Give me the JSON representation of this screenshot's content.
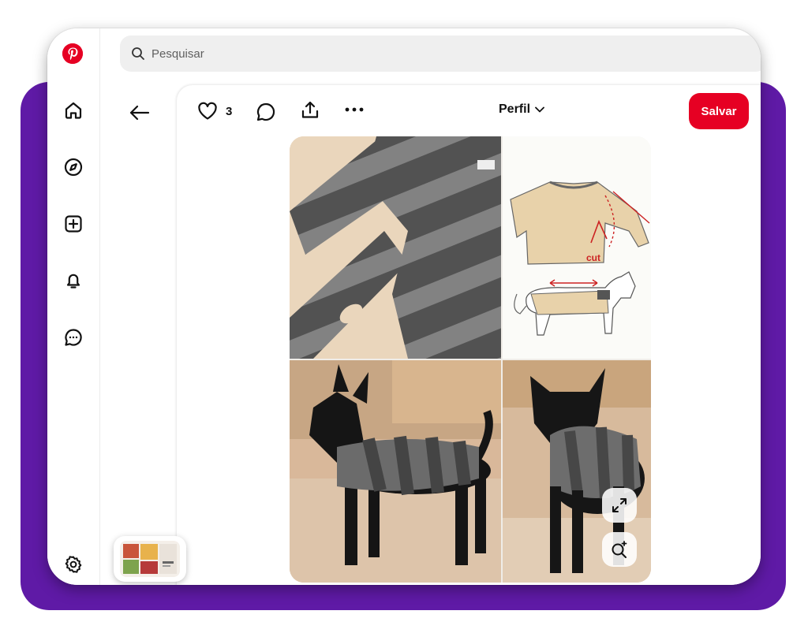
{
  "app": {
    "name": "Pinterest",
    "brand_color": "#e60023",
    "frame_color": "#5f1aa6"
  },
  "sidebar": {
    "items": [
      {
        "name": "home",
        "icon": "home-icon"
      },
      {
        "name": "explore",
        "icon": "compass-icon"
      },
      {
        "name": "create",
        "icon": "plus-square-icon"
      },
      {
        "name": "notifications",
        "icon": "bell-icon"
      },
      {
        "name": "messages",
        "icon": "chat-icon"
      },
      {
        "name": "settings",
        "icon": "gear-icon"
      }
    ]
  },
  "search": {
    "placeholder": "Pesquisar",
    "value": ""
  },
  "pin": {
    "like_count": "3",
    "profile_label": "Perfil",
    "save_label": "Salvar",
    "diagram_label": "cut",
    "image_description_icons": [
      "expand-icon",
      "visual-search-icon"
    ]
  }
}
